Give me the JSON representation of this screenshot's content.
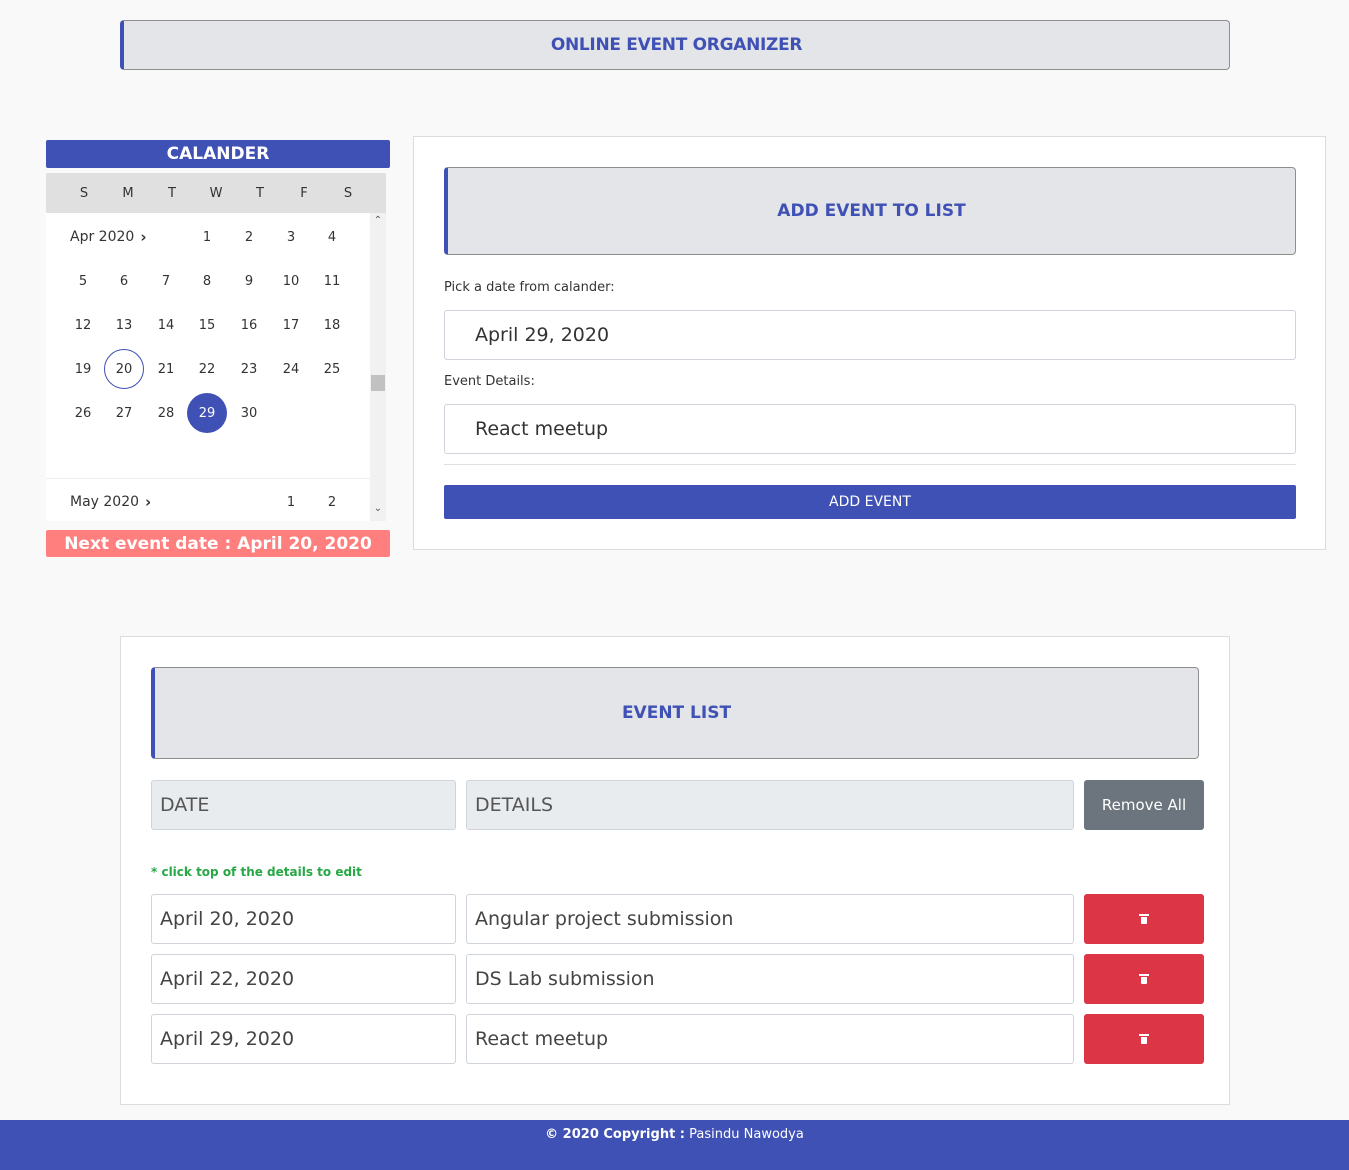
{
  "header": {
    "title": "ONLINE EVENT ORGANIZER"
  },
  "calendar": {
    "title": "CALANDER",
    "weekdays": [
      "S",
      "M",
      "T",
      "W",
      "T",
      "F",
      "S"
    ],
    "months": [
      {
        "label": "Apr 2020"
      },
      {
        "label": "May 2020"
      }
    ],
    "today": 20,
    "selected": 29,
    "next_event": "Next event date : April 20, 2020"
  },
  "add_event": {
    "heading": "ADD EVENT TO LIST",
    "date_label": "Pick a date from calander:",
    "date_value": "April 29, 2020",
    "details_label": "Event Details:",
    "details_value": "React meetup",
    "button": "ADD EVENT"
  },
  "event_list": {
    "heading": "EVENT LIST",
    "col_date": "DATE",
    "col_details": "DETAILS",
    "remove_all": "Remove All",
    "hint": "* click top of the details to edit",
    "rows": [
      {
        "date": "April 20, 2020",
        "details": "Angular project submission"
      },
      {
        "date": "April 22, 2020",
        "details": "DS Lab submission"
      },
      {
        "date": "April 29, 2020",
        "details": "React meetup"
      }
    ]
  },
  "footer": {
    "prefix": "© 2020 Copyright :",
    "name": "Pasindu Nawodya"
  },
  "colors": {
    "primary": "#3f51b5",
    "danger": "#dc3545",
    "secondary": "#6c757d",
    "next_event": "#ff7f7f",
    "hint": "#28a745"
  }
}
